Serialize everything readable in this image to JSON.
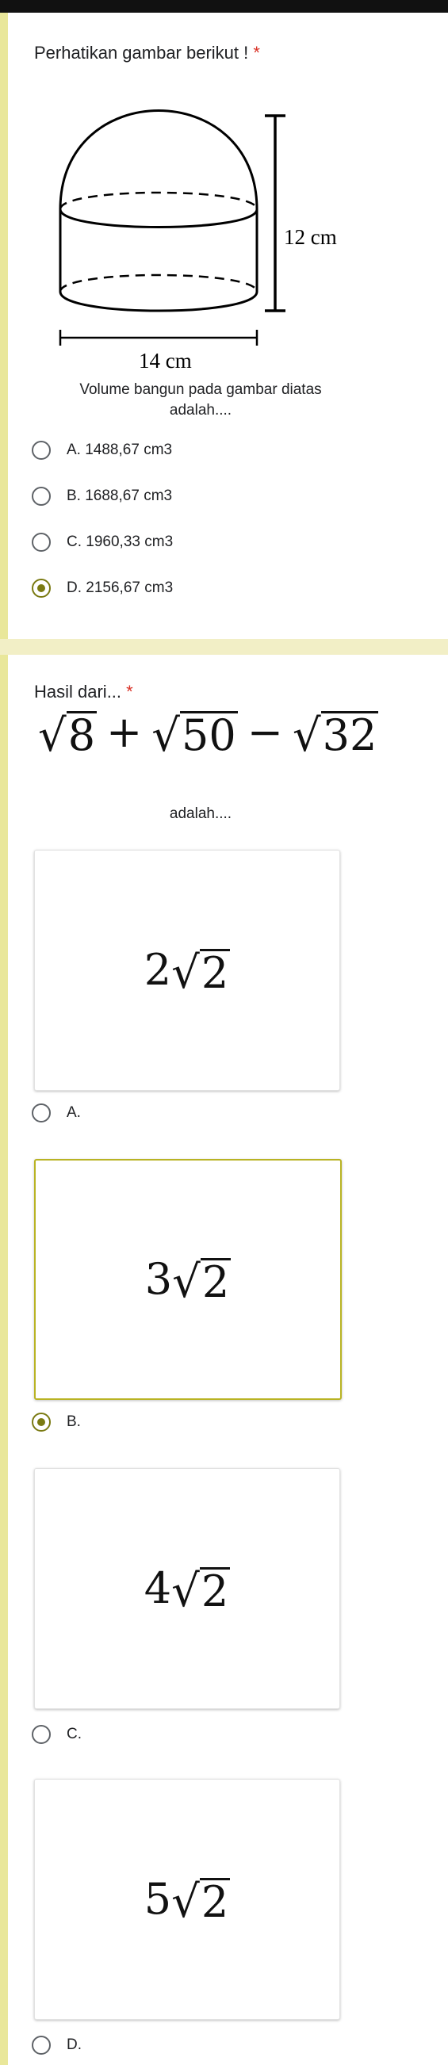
{
  "q1": {
    "title": "Perhatikan gambar berikut !",
    "required": "*",
    "figure": {
      "height_label": "12 cm",
      "width_label": "14 cm"
    },
    "caption_line1": "Volume bangun pada gambar diatas",
    "caption_line2": "adalah....",
    "options": [
      {
        "label": "A. 1488,67 cm3",
        "checked": false
      },
      {
        "label": "B. 1688,67 cm3",
        "checked": false
      },
      {
        "label": "C. 1960,33 cm3",
        "checked": false
      },
      {
        "label": "D. 2156,67 cm3",
        "checked": true
      }
    ]
  },
  "q2": {
    "title": "Hasil dari...",
    "required": "*",
    "expression": {
      "radicands": [
        "8",
        "50",
        "32"
      ],
      "operators": [
        "+",
        "−"
      ]
    },
    "caption": "adalah....",
    "options": [
      {
        "coef": "2",
        "radicand": "2",
        "label": "A.",
        "checked": false
      },
      {
        "coef": "3",
        "radicand": "2",
        "label": "B.",
        "checked": true
      },
      {
        "coef": "4",
        "radicand": "2",
        "label": "C.",
        "checked": false
      },
      {
        "coef": "5",
        "radicand": "2",
        "label": "D.",
        "checked": false
      }
    ]
  },
  "colors": {
    "accent": "#7a7a12",
    "page_background": "#f2efc6",
    "card_stripe": "#e9e79a",
    "required": "#d93025"
  }
}
